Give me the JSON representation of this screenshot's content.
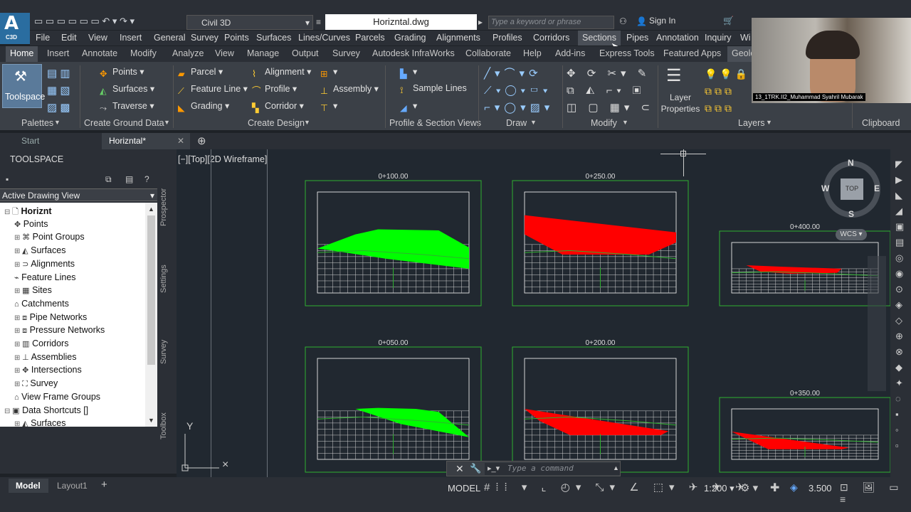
{
  "app": {
    "workspace": "Civil 3D",
    "document_title": "Horizntal.dwg",
    "search_placeholder": "Type a keyword or phrase",
    "sign_in": "Sign In",
    "logo": "A",
    "logo_sub": "C3D"
  },
  "menu": [
    "File",
    "Edit",
    "View",
    "Insert",
    "General",
    "Survey",
    "Points",
    "Surfaces",
    "Lines/Curves",
    "Parcels",
    "Grading",
    "Alignments",
    "Profiles",
    "Corridors",
    "Sections",
    "Pipes",
    "Annotation",
    "Inquiry",
    "Wi"
  ],
  "ribbon_tabs": [
    "Home",
    "Insert",
    "Annotate",
    "Modify",
    "Analyze",
    "View",
    "Manage",
    "Output",
    "Survey",
    "Autodesk InfraWorks",
    "Collaborate",
    "Help",
    "Add-ins",
    "Express Tools",
    "Featured Apps",
    "Geolo"
  ],
  "ribbon": {
    "toolspace": "Toolspace",
    "palettes": "Palettes",
    "create_ground": [
      "Points",
      "Surfaces",
      "Traverse"
    ],
    "create_ground_title": "Create Ground Data",
    "create_design": [
      "Parcel",
      "Feature Line",
      "Grading",
      "Alignment",
      "Profile",
      "Corridor",
      "Assembly"
    ],
    "create_design_title": "Create Design",
    "profile_section": "Sample Lines",
    "profile_section_title": "Profile & Section Views",
    "draw_title": "Draw",
    "modify_title": "Modify",
    "layers_title": "Layers",
    "layer_properties": "Layer Properties",
    "clipboard_title": "Clipboard"
  },
  "file_tabs": [
    "Start",
    "Horizntal*"
  ],
  "toolspace": {
    "title": "TOOLSPACE",
    "view": "Active Drawing View",
    "tree": [
      "Horiznt",
      "Points",
      "Point Groups",
      "Surfaces",
      "Alignments",
      "Feature Lines",
      "Sites",
      "Catchments",
      "Pipe Networks",
      "Pressure Networks",
      "Corridors",
      "Assemblies",
      "Intersections",
      "Survey",
      "View Frame Groups",
      "Data Shortcuts []",
      "Surfaces"
    ],
    "vtabs": [
      "Prospector",
      "Settings",
      "Survey",
      "Toolbox"
    ]
  },
  "viewport": {
    "label": "[−][Top][2D Wireframe]",
    "viewcube": {
      "top": "TOP",
      "n": "N",
      "s": "S",
      "e": "E",
      "w": "W",
      "wcs": "WCS"
    },
    "sections": [
      "0+100.00",
      "0+250.00",
      "0+400.00",
      "0+050.00",
      "0+200.00",
      "0+350.00"
    ]
  },
  "command": {
    "placeholder": "Type a command"
  },
  "status": {
    "model_tab": "Model",
    "layout_tab": "Layout1",
    "model": "MODEL",
    "scale": "1:200",
    "value": "3.500"
  },
  "webcam_name": "13_1TRK.II2_Muhammad Syahril Mubarak",
  "colors": {
    "cut": "#ff0000",
    "fill": "#00ff00",
    "frame": "#2fb02f"
  }
}
